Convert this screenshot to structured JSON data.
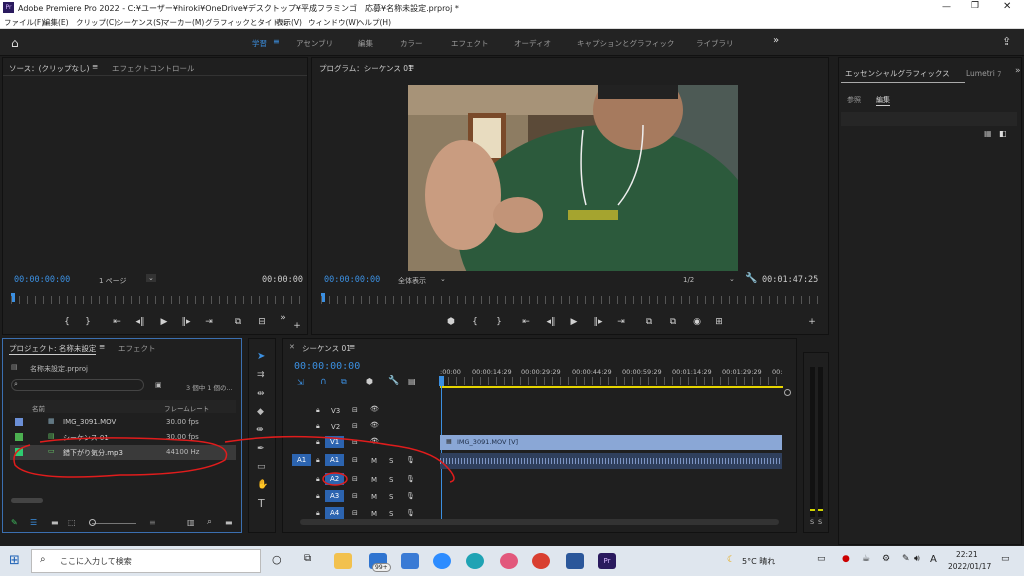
{
  "titlebar": {
    "title": "Adobe Premiere Pro 2022 - C:¥ユーザー¥hiroki¥OneDrive¥デスクトップ¥平成フラミンゴ　応募¥名称未設定.prproj *",
    "app_icon": "Pr"
  },
  "menu": [
    "ファイル(F)",
    "編集(E)",
    "クリップ(C)",
    "シーケンス(S)",
    "マーカー(M)",
    "グラフィックとタイトル",
    "表示(V)",
    "ウィンドウ(W)",
    "ヘルプ(H)"
  ],
  "workspaces": {
    "items": [
      "学習",
      "アセンブリ",
      "編集",
      "カラー",
      "エフェクト",
      "オーディオ",
      "キャプションとグラフィック",
      "ライブラリ"
    ],
    "more": "»"
  },
  "source": {
    "title": "ソース：(クリップなし)",
    "tab2": "エフェクトコントロール",
    "tc_left": "00:00:00:00",
    "page": "1 ページ",
    "tc_right": "00:00:00"
  },
  "program": {
    "title": "プログラム：シーケンス 01",
    "tc_left": "00:00:00:00",
    "fit": "全体表示",
    "res": "1/2",
    "tc_right": "00:01:47:25"
  },
  "essential": {
    "title": "エッセンシャルグラフィックス",
    "tab2": "Lumetri ﾌ",
    "sub1": "参照",
    "sub2": "編集"
  },
  "project": {
    "title": "プロジェクト: 名称未設定",
    "tab2": "エフェクト",
    "file": "名称未設定.prproj",
    "count": "3 個中 1 個の...",
    "col_name": "名前",
    "col_rate": "フレームレート",
    "items": [
      {
        "name": "IMG_3091.MOV",
        "rate": "30.00 fps",
        "color": "#6b8fd6"
      },
      {
        "name": "シーケンス 01",
        "rate": "30.00 fps",
        "color": "#4caf50"
      },
      {
        "name": "錯下がり気分.mp3",
        "rate": "44100 Hz",
        "color": "#2ecc71"
      }
    ]
  },
  "timeline": {
    "title": "シーケンス 01",
    "tc": "00:00:00:00",
    "ruler": [
      ":00:00",
      "00:00:14:29",
      "00:00:29:29",
      "00:00:44:29",
      "00:00:59:29",
      "00:01:14:29",
      "00:01:29:29",
      "00:"
    ],
    "tracks": [
      "V3",
      "V2",
      "V1",
      "A1",
      "A2",
      "A3",
      "A4"
    ],
    "src_a1": "A1",
    "clip": "IMG_3091.MOV [V]",
    "m": "M",
    "s": "S"
  },
  "meter": {
    "s1": "S",
    "s2": "S"
  },
  "taskbar": {
    "search": "ここに入力して検索",
    "badge": "99+",
    "weather": "5°C  晴れ",
    "ime": "A",
    "time": "22:21",
    "date": "2022/01/17"
  }
}
